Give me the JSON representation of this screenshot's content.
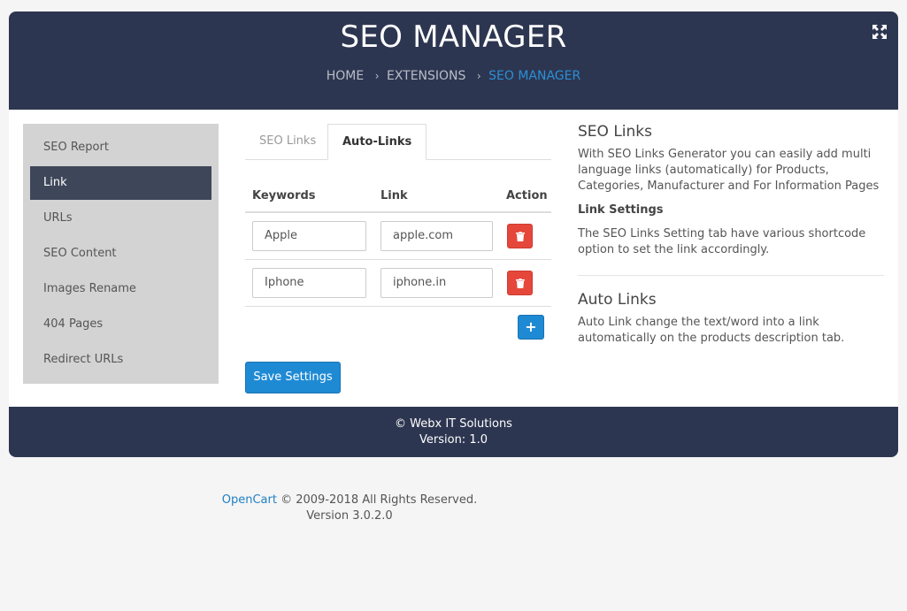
{
  "header": {
    "title": "SEO MANAGER",
    "breadcrumb": [
      "HOME",
      "EXTENSIONS",
      "SEO MANAGER"
    ],
    "separator": "›"
  },
  "sidebar": {
    "items": [
      {
        "label": "SEO Report"
      },
      {
        "label": "Link"
      },
      {
        "label": "URLs"
      },
      {
        "label": "SEO Content"
      },
      {
        "label": "Images Rename"
      },
      {
        "label": "404 Pages"
      },
      {
        "label": "Redirect URLs"
      }
    ],
    "active": "Link"
  },
  "tabs": [
    {
      "label": "SEO Links"
    },
    {
      "label": "Auto-Links"
    }
  ],
  "table": {
    "headers": [
      "Keywords",
      "Link",
      "Action"
    ],
    "rows": [
      {
        "keyword": "Apple",
        "link": "apple.com"
      },
      {
        "keyword": "Iphone",
        "link": "iphone.in"
      }
    ]
  },
  "buttons": {
    "add": "+",
    "save": "Save Settings"
  },
  "info": {
    "seo_links_title": "SEO Links",
    "seo_links_text": "With SEO Links Generator you can easily add multi language links (automatically) for Products, Categories, Manufacturer and For Information Pages",
    "link_settings_title": "Link Settings",
    "link_settings_text": "The SEO Links Setting tab have various shortcode option to set the link accordingly.",
    "auto_links_title": "Auto Links",
    "auto_links_text": "Auto Link change the text/word into a link automatically on the products description tab."
  },
  "footer": {
    "company": "© Webx IT Solutions",
    "version": "Version: 1.0"
  },
  "page_footer": {
    "link": "OpenCart",
    "copyright": " © 2009-2018 All Rights Reserved.",
    "version": "Version 3.0.2.0"
  },
  "colors": {
    "header_bg": "#2d3651",
    "accent": "#1f8ad4",
    "danger": "#e5473b",
    "sidebar_active": "#3e4659"
  }
}
